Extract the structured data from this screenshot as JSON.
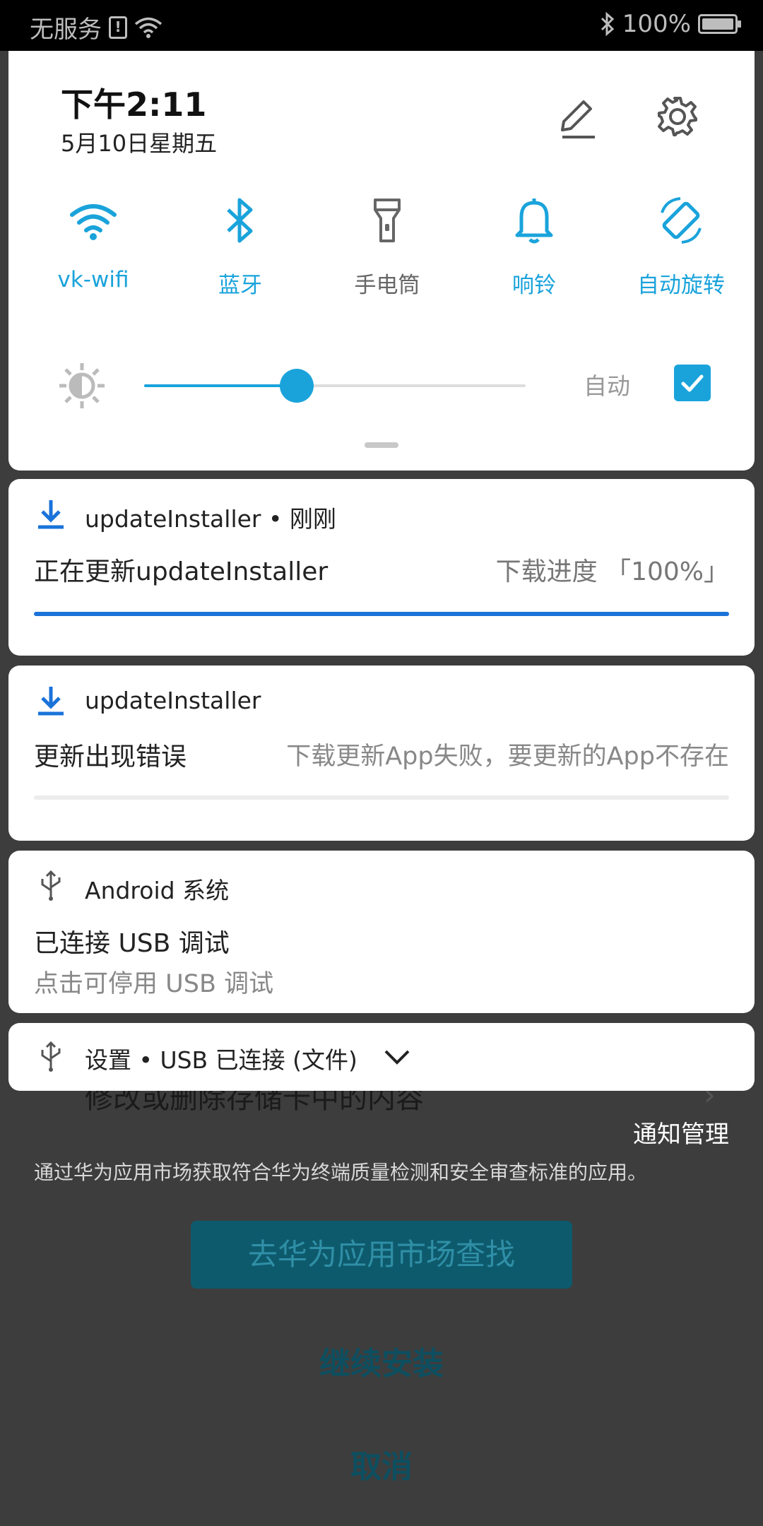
{
  "status_bar": {
    "carrier": "无服务",
    "sim_icon": "sim-alert-icon",
    "battery": "100%",
    "battery_level": 1.0
  },
  "quick_settings": {
    "time": "下午2:11",
    "date": "5月10日星期五",
    "tiles": [
      {
        "label": "vk-wifi",
        "icon": "wifi-icon",
        "active": true
      },
      {
        "label": "蓝牙",
        "icon": "bluetooth-icon",
        "active": true
      },
      {
        "label": "手电筒",
        "icon": "flashlight-icon",
        "active": false
      },
      {
        "label": "响铃",
        "icon": "bell-icon",
        "active": true
      },
      {
        "label": "自动旋转",
        "icon": "auto-rotate-icon",
        "active": true
      }
    ],
    "brightness": 0.4,
    "auto_label": "自动",
    "auto_checked": true,
    "accent_color": "#1aa3db"
  },
  "notifications": [
    {
      "app": "updateInstaller • 刚刚",
      "title": "正在更新updateInstaller",
      "detail": "下载进度 「100%」",
      "progress": 1.0,
      "progress_color": "#1a73d9"
    },
    {
      "app": "updateInstaller",
      "title": "更新出现错误",
      "detail": "下载更新App失败，要更新的App不存在",
      "progress": 0.0
    },
    {
      "app": "Android 系统",
      "title": "已连接 USB 调试",
      "detail": "点击可停用 USB 调试"
    },
    {
      "app": "设置 • USB 已连接 (文件)"
    }
  ],
  "notification_manage": "通知管理",
  "background": {
    "item_label": "修改或删除存储卡中的内容",
    "description": "通过华为应用市场获取符合华为终端质量检测和安全审查标准的应用。",
    "market_button": "去华为应用市场查找",
    "continue_button": "继续安装",
    "cancel_button": "取消"
  }
}
